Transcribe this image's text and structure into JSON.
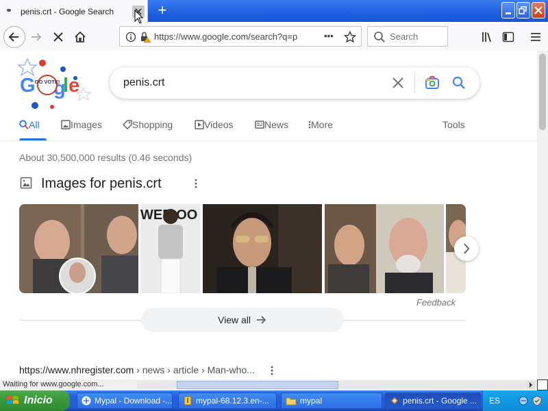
{
  "browser": {
    "tab_title": "penis.crt - Google Search",
    "new_tab_label": "+",
    "url": "https://www.google.com/search?q=p",
    "more_label": "•••",
    "search_placeholder": "Search",
    "status": "Waiting for www.google.com..."
  },
  "google": {
    "logo_badge": "GO VOTE!",
    "query": "penis.crt",
    "tabs": [
      {
        "label": "All",
        "icon": "search-icon"
      },
      {
        "label": "Images",
        "icon": "image-icon"
      },
      {
        "label": "Shopping",
        "icon": "tag-icon"
      },
      {
        "label": "Videos",
        "icon": "play-icon"
      },
      {
        "label": "News",
        "icon": "news-icon"
      },
      {
        "label": "More",
        "icon": "kebab-icon"
      }
    ],
    "tools_label": "Tools",
    "stats": "About 30,500,000 results (0.46 seconds)",
    "images_title": "Images for penis.crt",
    "feedback_label": "Feedback",
    "view_all_label": "View all",
    "thumb_text": "WER OO",
    "result_cite_domain": "https://www.nhregister.com",
    "result_cite_path": " › news › article › Man-who..."
  },
  "taskbar": {
    "start_label": "Inicio",
    "tasks": [
      {
        "label": "Mypal - Download -..."
      },
      {
        "label": "mypal-68.12.3.en-..."
      },
      {
        "label": "mypal"
      },
      {
        "label": "penis.crt - Google ..."
      }
    ],
    "language": "ES"
  },
  "colors": {
    "google_blue": "#1a73e8",
    "xp_blue": "#245edb",
    "xp_green": "#3c9a3c"
  }
}
